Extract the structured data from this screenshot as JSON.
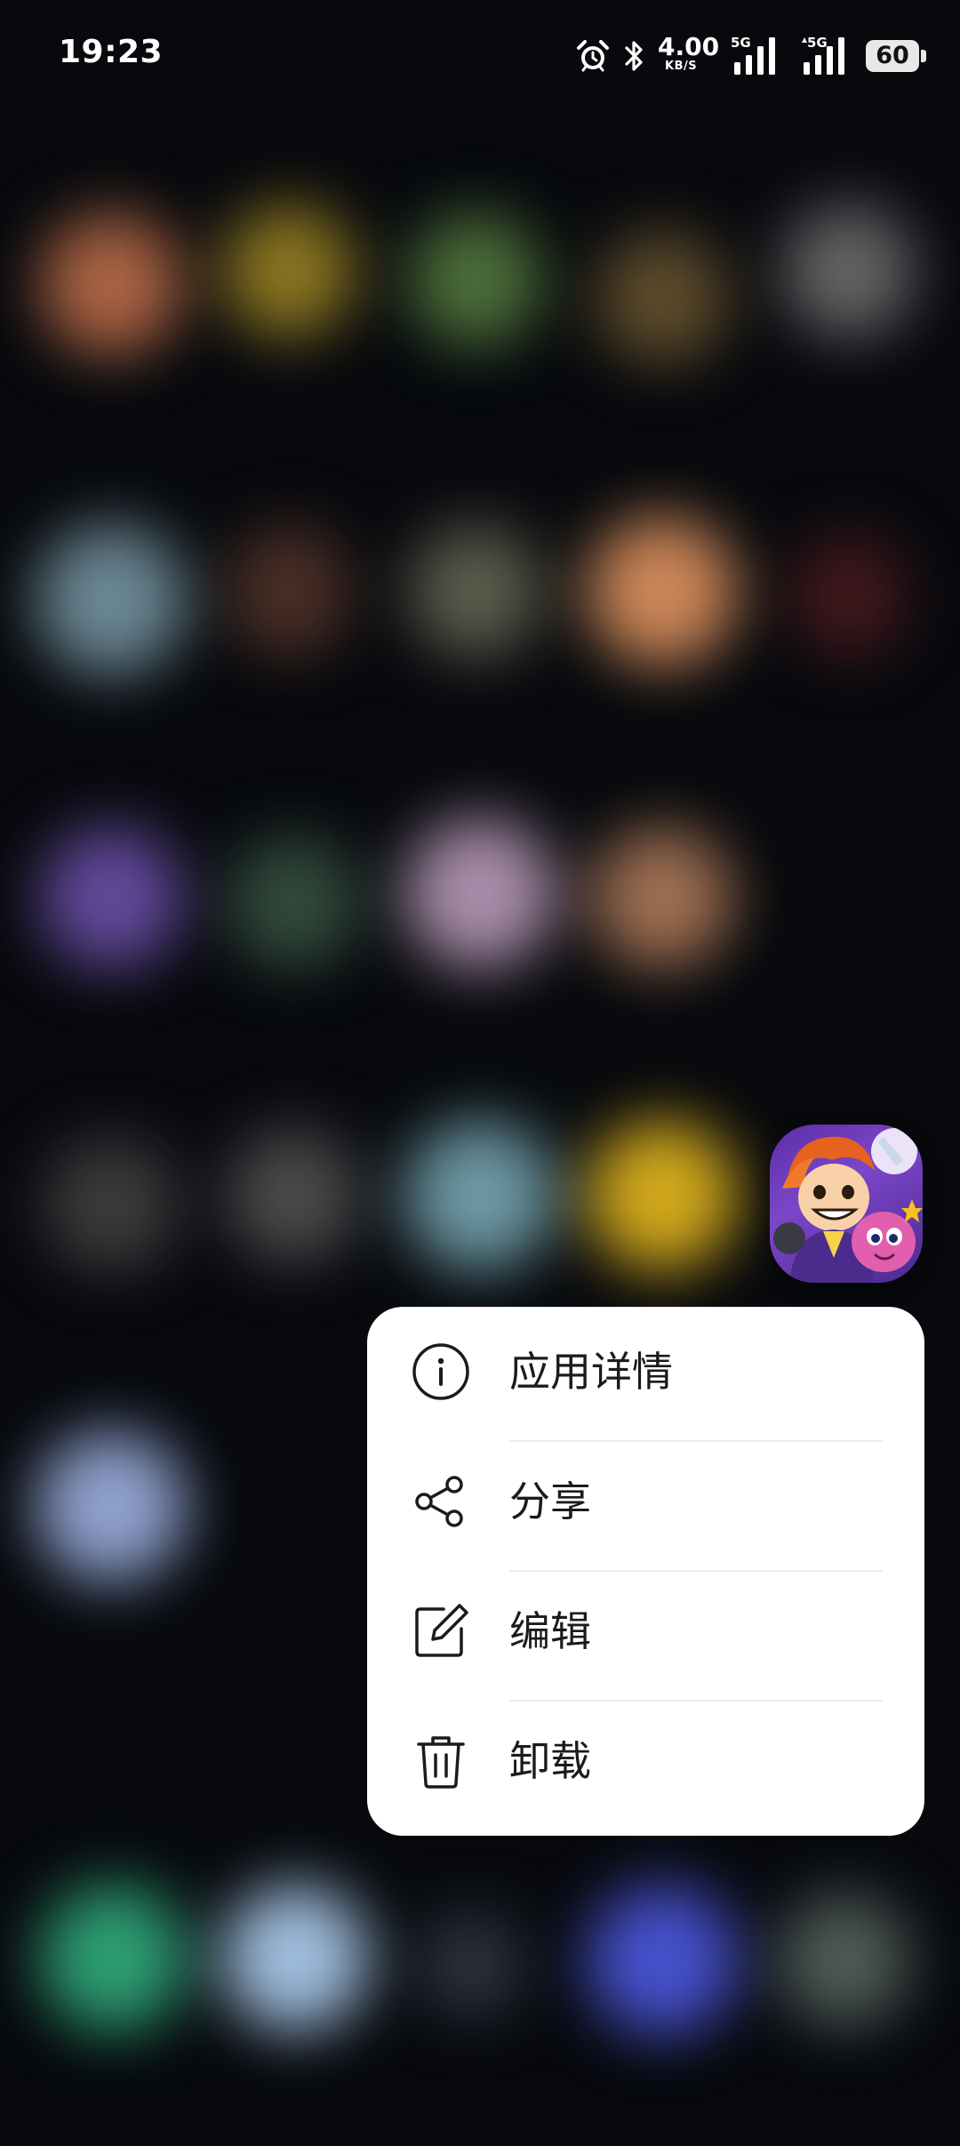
{
  "status_bar": {
    "time": "19:23",
    "net_speed": "4.00",
    "net_speed_unit": "KB/S",
    "sim1_tag": "5G",
    "sim2_tag": "5G",
    "battery": "60",
    "icons": [
      "alarm-icon",
      "bluetooth-icon",
      "signal-icon",
      "signal-icon"
    ]
  },
  "focused_app": {
    "icon": "game-character-icon"
  },
  "context_menu": {
    "items": [
      {
        "label": "应用详情",
        "icon": "info-icon"
      },
      {
        "label": "分享",
        "icon": "share-icon"
      },
      {
        "label": "编辑",
        "icon": "edit-icon"
      },
      {
        "label": "卸载",
        "icon": "trash-icon"
      }
    ]
  },
  "colors": {
    "background": "#07090d",
    "menu_background": "#ffffff",
    "menu_text": "#1b1b1b"
  }
}
